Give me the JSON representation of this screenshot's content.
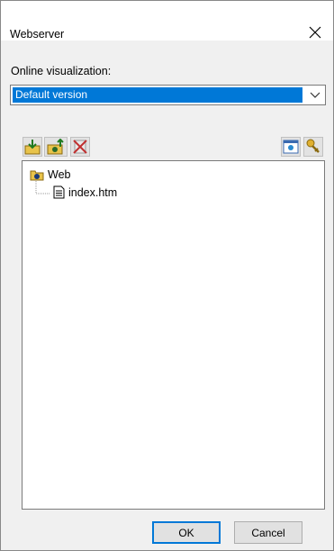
{
  "dialog": {
    "title": "Webserver"
  },
  "online_visualization": {
    "label": "Online visualization:",
    "selected": "Default version"
  },
  "toolbar": {
    "left": [
      "import-icon",
      "export-icon",
      "delete-icon"
    ],
    "right": [
      "browser-icon",
      "settings-icon"
    ]
  },
  "tree": {
    "root": "Web",
    "children": [
      "index.htm"
    ]
  },
  "buttons": {
    "ok": "OK",
    "cancel": "Cancel"
  }
}
